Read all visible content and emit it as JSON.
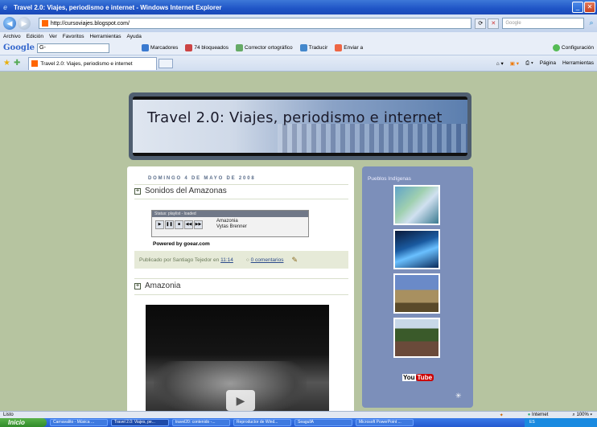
{
  "window": {
    "title": "Travel 2.0: Viajes, periodismo e internet - Windows Internet Explorer",
    "minimize": "_",
    "close": "✕"
  },
  "address": {
    "url": "http://cursoviajes.blogspot.com/",
    "search_placeholder": "Google"
  },
  "menu": [
    "Archivo",
    "Edición",
    "Ver",
    "Favoritos",
    "Herramientas",
    "Ayuda"
  ],
  "google_toolbar": {
    "logo": "Google",
    "search_value": "G-",
    "items": [
      "Marcadores",
      "74 bloqueados",
      "Corrector ortográfico",
      "Traducir",
      "Enviar a"
    ],
    "settings": "Configuración"
  },
  "tabs": {
    "active_label": "Travel 2.0: Viajes, periodismo e internet",
    "commands": [
      "Página",
      "Herramientas"
    ]
  },
  "blog": {
    "header_title": "Travel 2.0: Viajes, periodismo e internet",
    "date": "DOMINGO 4 DE MAYO DE 2008",
    "post1": {
      "title": "Sonidos del Amazonas",
      "player_status": "Status: playlist - loaded",
      "track_title": "Amazonia",
      "track_artist": "Vytas Brenner",
      "powered": "Powered by goear.com",
      "published_by": "Publicado por Santiago Tejedor",
      "at": "en",
      "time": "11:14",
      "comments": "0 comentarios"
    },
    "post2": {
      "title": "Amazonia"
    },
    "sidebar": {
      "title": "Pueblos Indígenas",
      "youtube_you": "You",
      "youtube_tube": "Tube"
    }
  },
  "statusbar": {
    "left": "Listo",
    "zone": "Internet",
    "zoom": "100%"
  },
  "taskbar": {
    "start": "Inicio",
    "tasks": [
      "Carnavalito - Música ...",
      "Travel 2.0: Viajes, pe...",
      "travel20: contenido -...",
      "Reproductor de Wind...",
      "SeagullA",
      "Microsoft PowerPoint ..."
    ],
    "tray": "ES"
  }
}
